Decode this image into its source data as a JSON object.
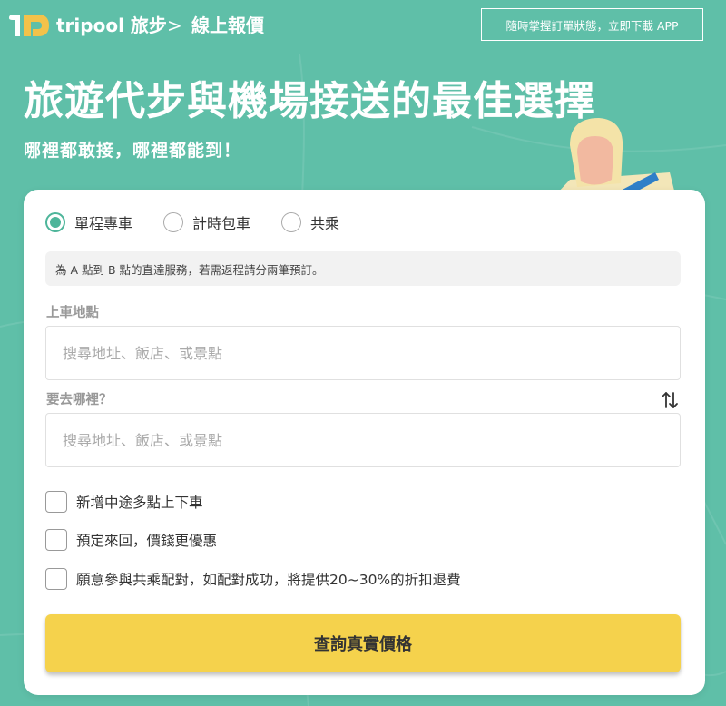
{
  "header": {
    "brand": "tripool 旅步",
    "separator": ">",
    "page": "線上報價",
    "app_button": "隨時掌握訂單狀態，立即下載 APP"
  },
  "hero": {
    "title": "旅遊代步與機場接送的最佳選擇",
    "subtitle": "哪裡都敢接，哪裡都能到！"
  },
  "form": {
    "service_types": [
      {
        "label": "單程專車",
        "selected": true
      },
      {
        "label": "計時包車",
        "selected": false
      },
      {
        "label": "共乘",
        "selected": false
      }
    ],
    "info": "為 A 點到 B 點的直達服務，若需返程請分兩筆預訂。",
    "pickup": {
      "label": "上車地點",
      "placeholder": "搜尋地址、飯店、或景點",
      "value": ""
    },
    "destination": {
      "label": "要去哪裡？",
      "placeholder": "搜尋地址、飯店、或景點",
      "value": ""
    },
    "options": [
      {
        "label": "新增中途多點上下車",
        "checked": false
      },
      {
        "label": "預定來回，價錢更優惠",
        "checked": false
      },
      {
        "label": "願意參與共乘配對，如配對成功，將提供20~30%的折扣退費",
        "checked": false
      }
    ],
    "submit": "查詢真實價格"
  },
  "colors": {
    "background": "#5fbfa8",
    "accent": "#4db59a",
    "button": "#f5d24c",
    "logo_yellow": "#f3c24a"
  },
  "icons": [
    "logo-icon",
    "swap-icon",
    "illustration-person"
  ]
}
